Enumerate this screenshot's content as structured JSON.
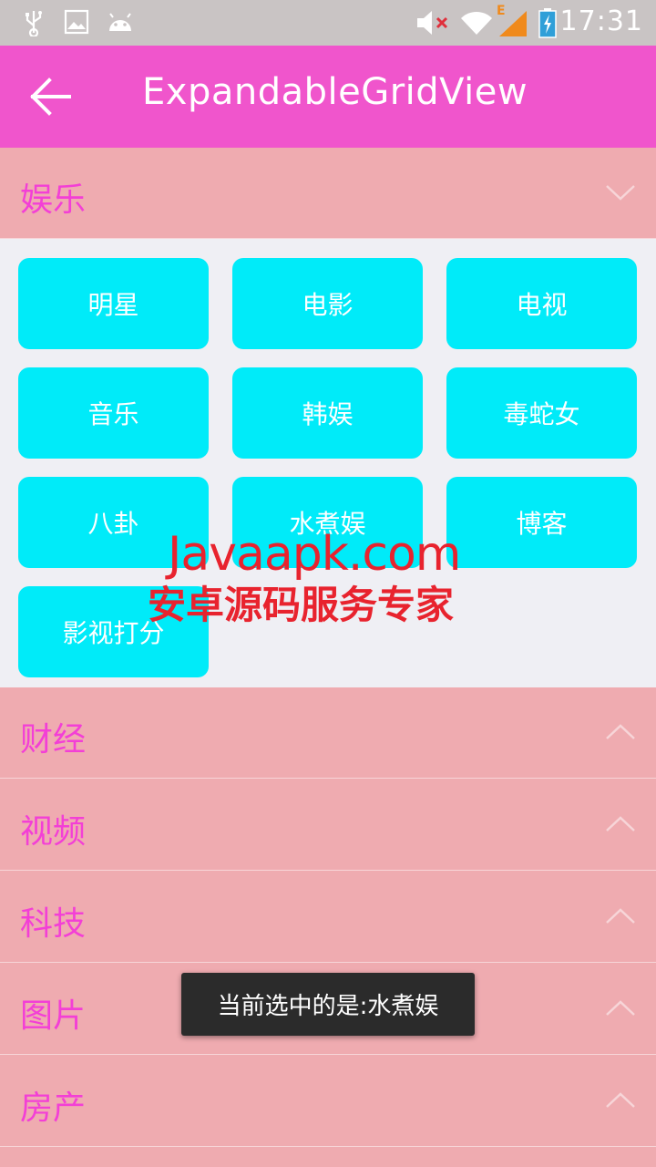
{
  "status_bar": {
    "time": "17:31",
    "icons": [
      "usb-icon",
      "image-icon",
      "android-icon",
      "mute-icon",
      "wifi-icon",
      "signal-icon",
      "battery-icon"
    ],
    "signal_label": "E"
  },
  "app_bar": {
    "title": "ExpandableGridView",
    "back_icon": "arrow-left-icon"
  },
  "groups": [
    {
      "label": "娱乐",
      "expanded": true
    },
    {
      "label": "财经",
      "expanded": false
    },
    {
      "label": "视频",
      "expanded": false
    },
    {
      "label": "科技",
      "expanded": false
    },
    {
      "label": "图片",
      "expanded": false
    },
    {
      "label": "房产",
      "expanded": false
    }
  ],
  "grid_items": [
    "明星",
    "电影",
    "电视",
    "音乐",
    "韩娱",
    "毒蛇女",
    "八卦",
    "水煮娱",
    "博客",
    "影视打分"
  ],
  "watermark": {
    "line1": "Javaapk.com",
    "line2": "安卓源码服务专家"
  },
  "toast": {
    "text": "当前选中的是:水煮娱"
  },
  "colors": {
    "app_bar": "#f055cc",
    "group_bg": "#efabb0",
    "group_text": "#f33fd6",
    "grid_cell": "#00ebf9",
    "panel_bg": "#efeff4"
  }
}
